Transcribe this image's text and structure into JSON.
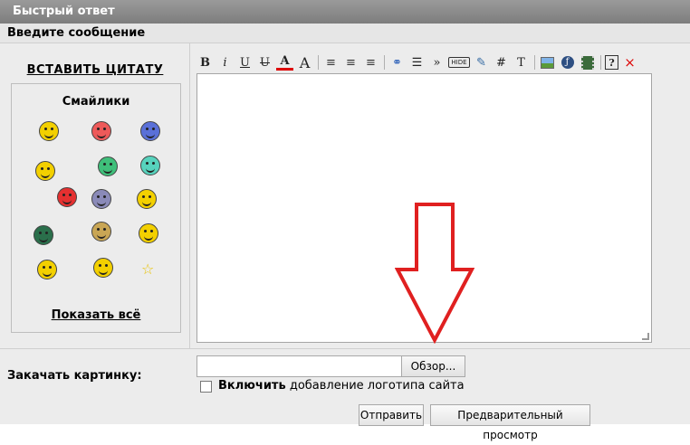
{
  "header": {
    "title": "Быстрый ответ",
    "subtitle": "Введите сообщение"
  },
  "sidebar": {
    "insert_quote": "ВСТАВИТЬ ЦИТАТУ",
    "smilies_title": "Смайлики",
    "show_all": "Показать всё",
    "smilies": [
      {
        "name": "cool-smiley",
        "color": "#f3d000"
      },
      {
        "name": "love-smiley",
        "color": "#ee5a5a"
      },
      {
        "name": "crying-smiley",
        "color": "#5a70d8"
      },
      {
        "name": "thinking-smiley",
        "color": "#f3d000"
      },
      {
        "name": "gun-smiley",
        "color": "#3fbf7a"
      },
      {
        "name": "teal-smiley",
        "color": "#57d3bd"
      },
      {
        "name": "red-ball-smiley",
        "color": "#e53030"
      },
      {
        "name": "gray-smiley",
        "color": "#8a8ab8"
      },
      {
        "name": "cheer-smiley",
        "color": "#f3d000"
      },
      {
        "name": "dark-smiley",
        "color": "#2a6f4b"
      },
      {
        "name": "clap-smiley",
        "color": "#c9a655"
      },
      {
        "name": "girl-smiley",
        "color": "#f3d000"
      },
      {
        "name": "antlers-smiley",
        "color": "#f3d000"
      },
      {
        "name": "laugh-smiley",
        "color": "#f3d000"
      },
      {
        "name": "star",
        "color": "#f3d000"
      }
    ]
  },
  "toolbar": {
    "bold": "B",
    "italic": "i",
    "underline": "U",
    "strike": "U",
    "font_color": "A",
    "font_size": "A",
    "align_left": "≡",
    "align_center": "≡",
    "align_right": "≡",
    "link": "⚭",
    "list": "☰",
    "quote": "»",
    "hide": "HIDE",
    "edit": "✎",
    "hash": "#",
    "text": "T",
    "help": "?",
    "close": "×"
  },
  "upload": {
    "label": "Закачать картинку:",
    "browse": "Обзор...",
    "checkbox_bold": "Включить",
    "checkbox_text": "добавление логотипа сайта"
  },
  "buttons": {
    "submit": "Отправить",
    "preview": "Предварительный просмотр"
  }
}
